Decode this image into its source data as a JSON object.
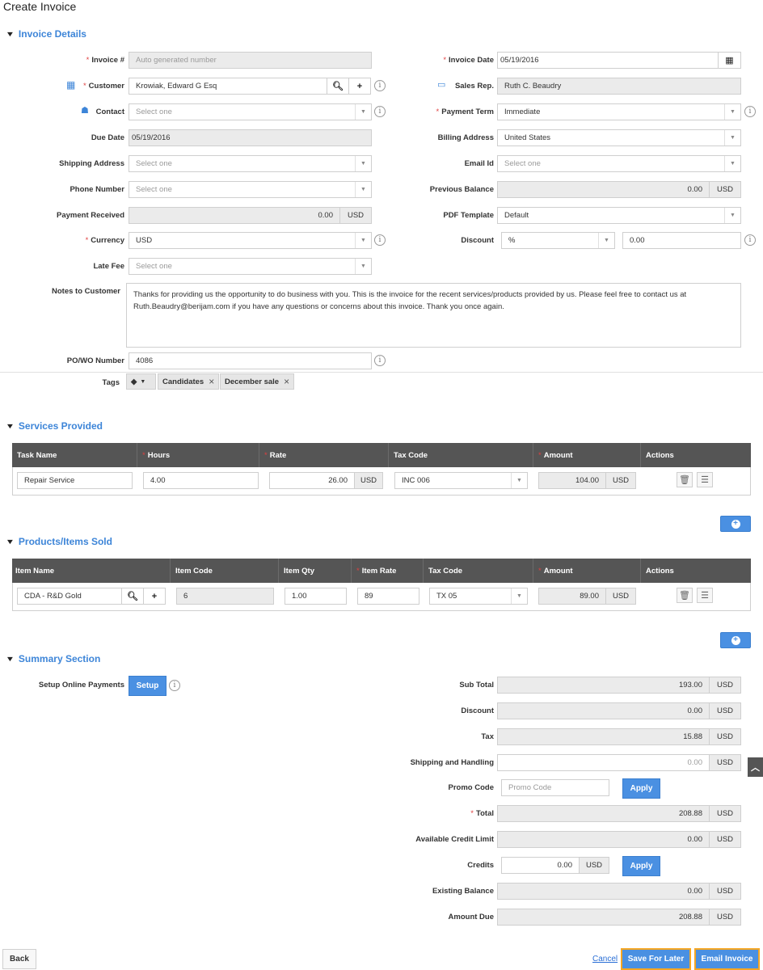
{
  "page_title": "Create Invoice",
  "invoice_details": {
    "heading": "Invoice Details",
    "invoice_no": {
      "label": "Invoice #",
      "placeholder": "Auto generated number"
    },
    "customer": {
      "label": "Customer",
      "value": "Krowiak, Edward G Esq"
    },
    "contact": {
      "label": "Contact",
      "placeholder": "Select one"
    },
    "due_date": {
      "label": "Due Date",
      "value": "05/19/2016"
    },
    "shipping_address": {
      "label": "Shipping Address",
      "placeholder": "Select one"
    },
    "phone_number": {
      "label": "Phone Number",
      "placeholder": "Select one"
    },
    "payment_received": {
      "label": "Payment Received",
      "value": "0.00",
      "unit": "USD"
    },
    "currency": {
      "label": "Currency",
      "value": "USD"
    },
    "late_fee": {
      "label": "Late Fee",
      "placeholder": "Select one"
    },
    "notes": {
      "label": "Notes to Customer",
      "value": "Thanks for providing us the opportunity to do business with you. This is the invoice for the recent services/products provided by us. Please feel free to contact us at Ruth.Beaudry@berijam.com if you have any questions or concerns about this invoice. Thank you once again."
    },
    "po_wo": {
      "label": "PO/WO Number",
      "value": "4086"
    },
    "tags": {
      "label": "Tags",
      "items": [
        "Candidates",
        "December sale"
      ],
      "close_glyph": "×"
    },
    "invoice_date": {
      "label": "Invoice Date",
      "value": "05/19/2016"
    },
    "sales_rep": {
      "label": "Sales Rep.",
      "value": "Ruth C. Beaudry"
    },
    "payment_term": {
      "label": "Payment Term",
      "value": "Immediate"
    },
    "billing_address": {
      "label": "Billing Address",
      "value": "United States"
    },
    "email_id": {
      "label": "Email Id",
      "placeholder": "Select one"
    },
    "previous_balance": {
      "label": "Previous Balance",
      "value": "0.00",
      "unit": "USD"
    },
    "pdf_template": {
      "label": "PDF Template",
      "value": "Default"
    },
    "discount": {
      "label": "Discount",
      "type_value": "%",
      "value": "0.00"
    }
  },
  "services": {
    "heading": "Services Provided",
    "columns": [
      "Task Name",
      "Hours",
      "Rate",
      "Tax Code",
      "Amount",
      "Actions"
    ],
    "row": {
      "task_name": "Repair Service",
      "hours": "4.00",
      "rate": "26.00",
      "rate_unit": "USD",
      "tax_code": "INC 006",
      "amount": "104.00",
      "amount_unit": "USD"
    }
  },
  "products": {
    "heading": "Products/Items Sold",
    "columns": [
      "Item Name",
      "Item Code",
      "Item Qty",
      "Item Rate",
      "Tax Code",
      "Amount",
      "Actions"
    ],
    "row": {
      "item_name": "CDA - R&D Gold",
      "item_code": "6",
      "item_qty": "1.00",
      "item_rate": "89",
      "tax_code": "TX 05",
      "amount": "89.00",
      "amount_unit": "USD"
    }
  },
  "summary": {
    "heading": "Summary Section",
    "setup_label": "Setup Online Payments",
    "setup_button": "Setup",
    "sub_total": {
      "label": "Sub Total",
      "value": "193.00",
      "unit": "USD"
    },
    "discount": {
      "label": "Discount",
      "value": "0.00",
      "unit": "USD"
    },
    "tax": {
      "label": "Tax",
      "value": "15.88",
      "unit": "USD"
    },
    "shipping": {
      "label": "Shipping and Handling",
      "placeholder": "0.00",
      "unit": "USD"
    },
    "promo": {
      "label": "Promo Code",
      "placeholder": "Promo Code",
      "apply": "Apply"
    },
    "total": {
      "label": "Total",
      "value": "208.88",
      "unit": "USD"
    },
    "credit_limit": {
      "label": "Available Credit Limit",
      "value": "0.00",
      "unit": "USD"
    },
    "credits": {
      "label": "Credits",
      "value": "0.00",
      "unit": "USD",
      "apply": "Apply"
    },
    "existing_balance": {
      "label": "Existing Balance",
      "value": "0.00",
      "unit": "USD"
    },
    "amount_due": {
      "label": "Amount Due",
      "value": "208.88",
      "unit": "USD"
    }
  },
  "footer": {
    "back": "Back",
    "cancel": "Cancel",
    "save_later": "Save For Later",
    "email_invoice": "Email Invoice"
  },
  "colors": {
    "accent": "#4a90e2",
    "header_bg": "#555555",
    "highlight": "#f5a623",
    "required": "#e04040"
  }
}
